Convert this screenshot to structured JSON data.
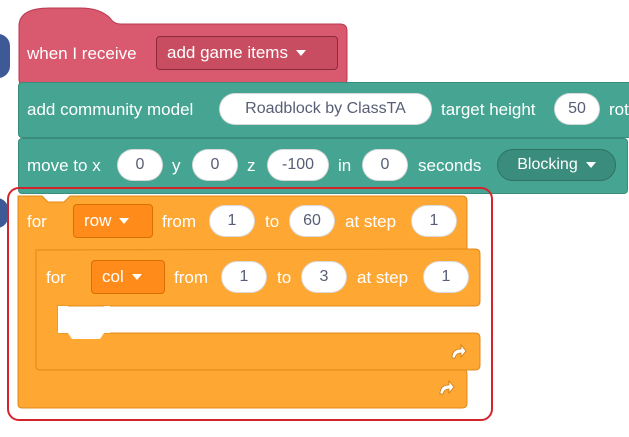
{
  "event_block": {
    "label": "when I receive",
    "message": "add game items"
  },
  "model_block": {
    "label": "add community model",
    "model": "Roadblock by ClassTA",
    "height_label": "target height",
    "height_value": "50",
    "cut_text": "rot"
  },
  "move_block": {
    "label": "move to x",
    "x": "0",
    "y_label": "y",
    "y": "0",
    "z_label": "z",
    "z": "-100",
    "in_label": "in",
    "seconds_value": "0",
    "seconds_label": "seconds",
    "mode": "Blocking"
  },
  "outer_for": {
    "label": "for",
    "var": "row",
    "from_label": "from",
    "from": "1",
    "to_label": "to",
    "to": "60",
    "step_label": "at step",
    "step": "1"
  },
  "inner_for": {
    "label": "for",
    "var": "col",
    "from_label": "from",
    "from": "1",
    "to_label": "to",
    "to": "3",
    "step_label": "at step",
    "step": "1"
  },
  "colors": {
    "event": "#d9596e",
    "event_dark": "#b8394f",
    "teal": "#45a592",
    "teal_dark": "#3a8c7c",
    "orange": "#ffa733",
    "orange_dark": "#e08a1a",
    "highlight": "#d6232b"
  }
}
